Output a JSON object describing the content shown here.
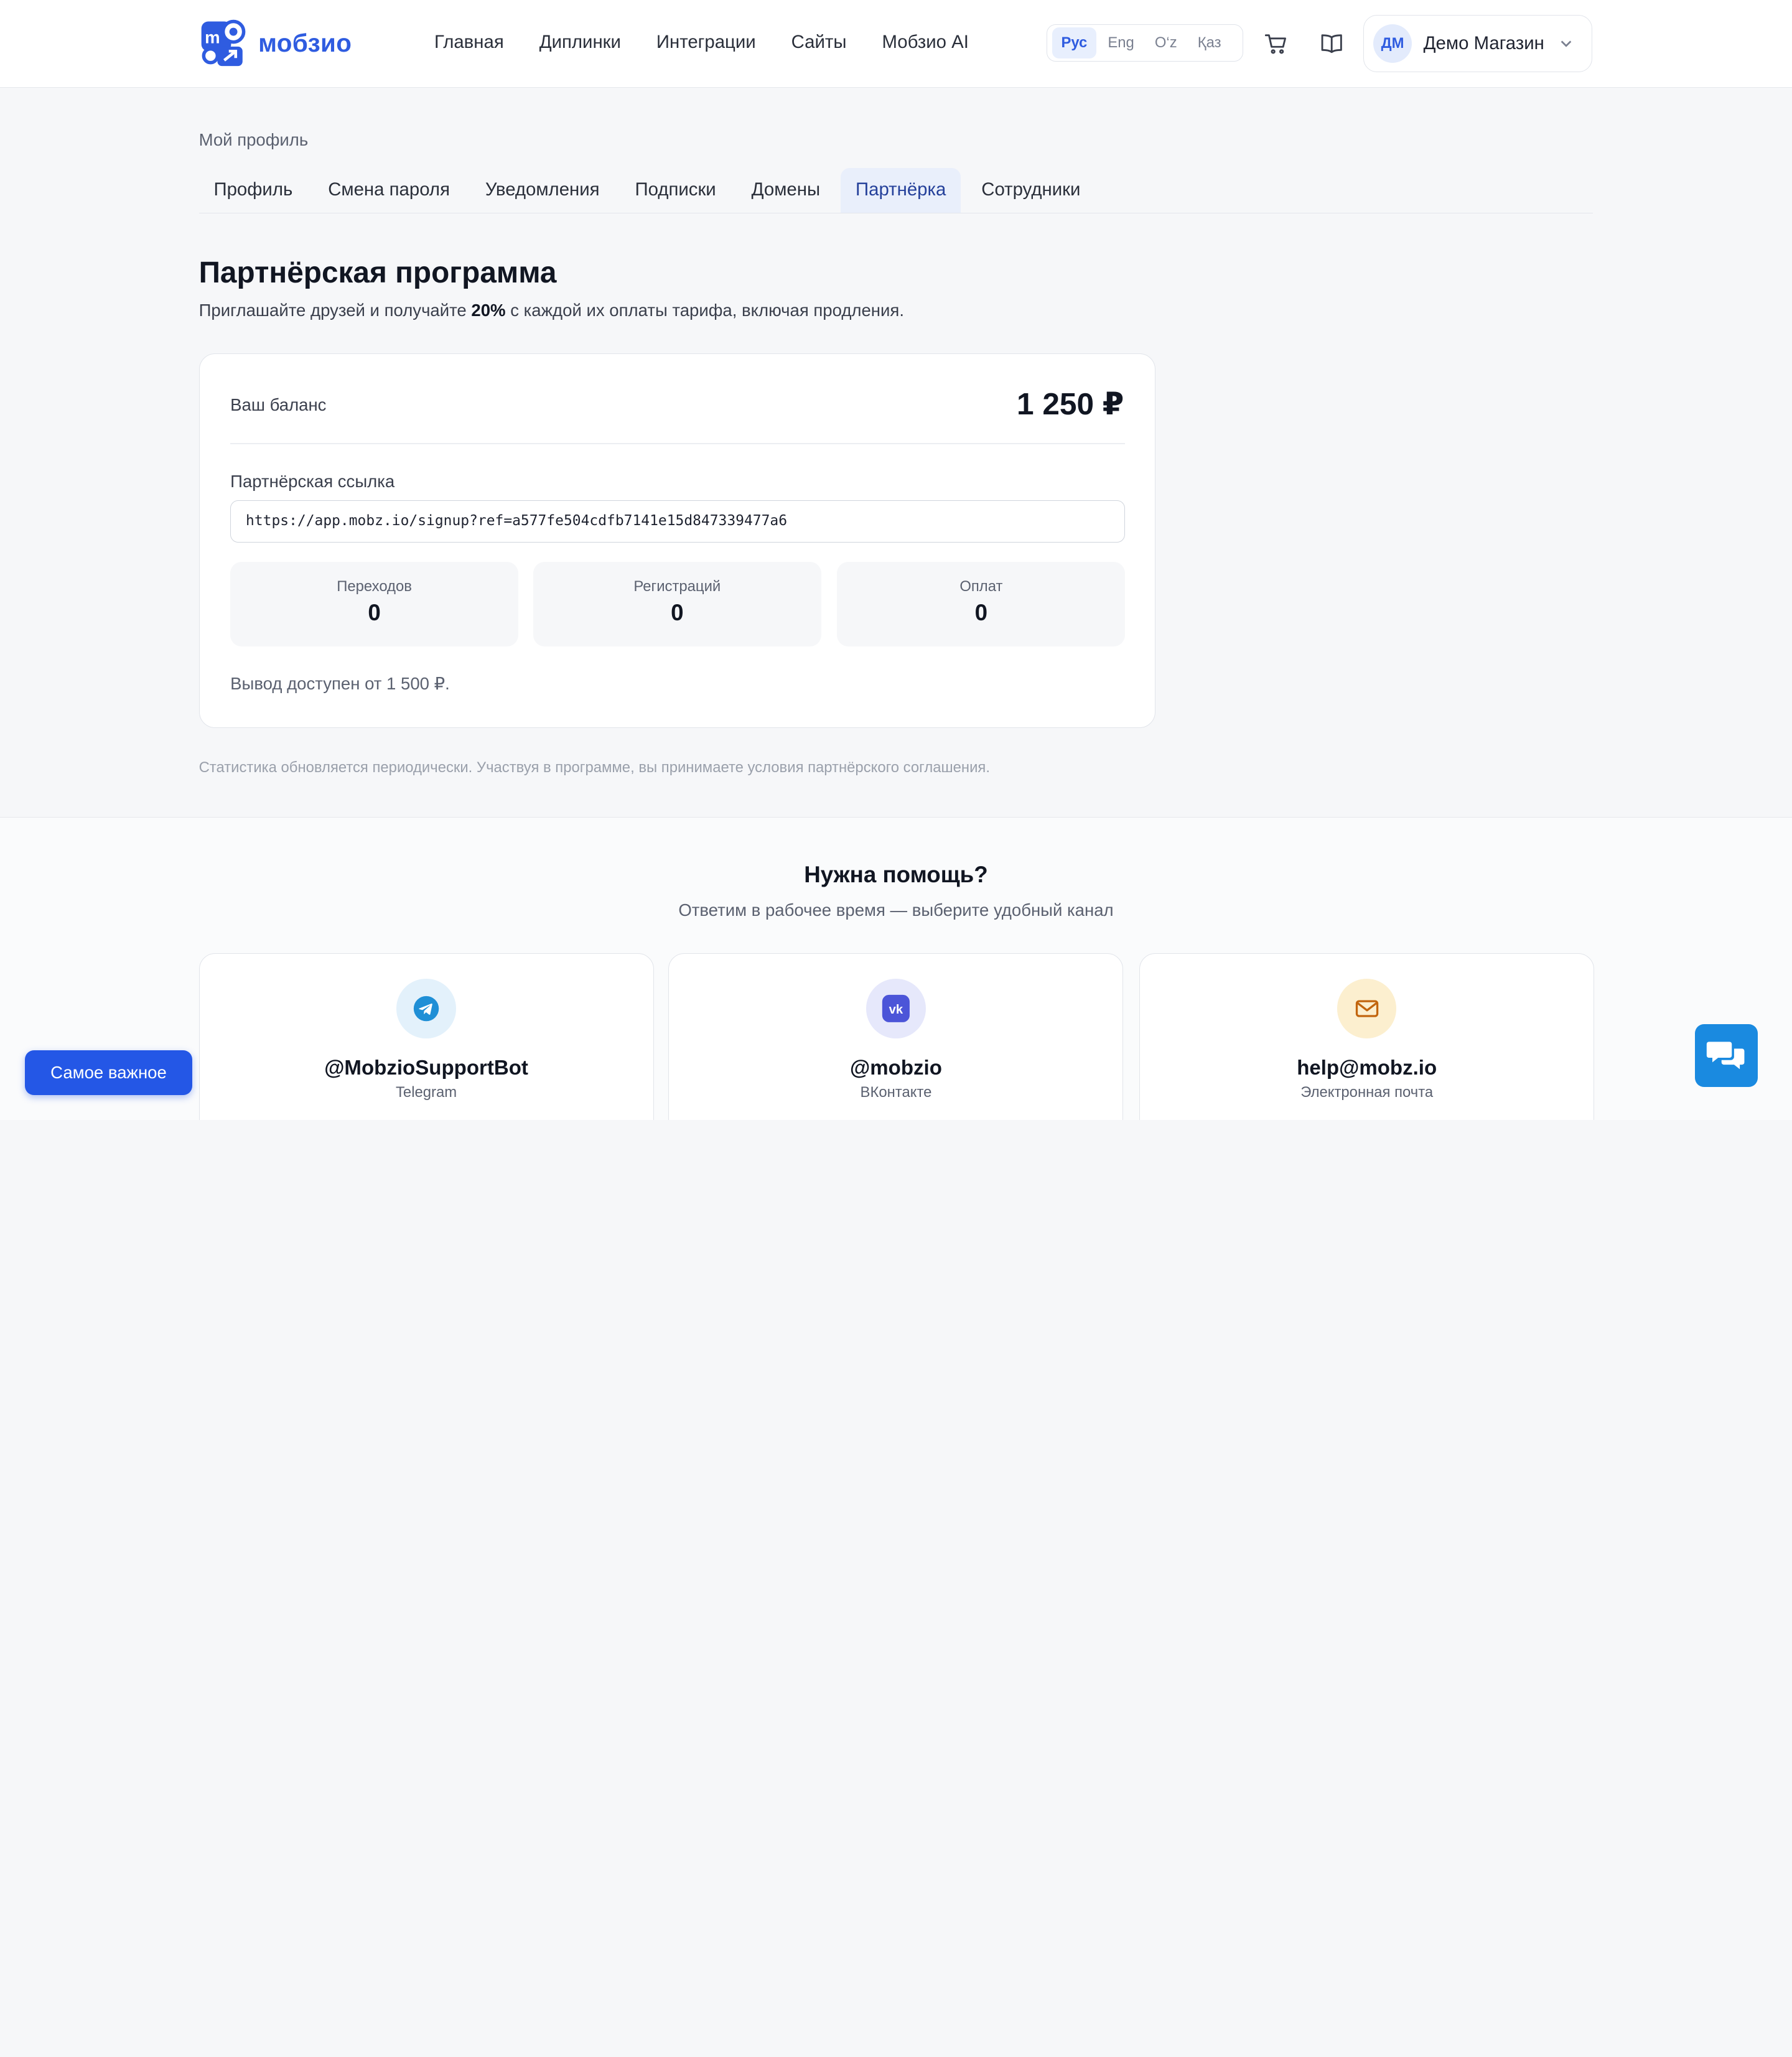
{
  "header": {
    "logo_text": "мобзио",
    "nav": [
      "Главная",
      "Диплинки",
      "Интеграции",
      "Сайты",
      "Мобзио AI"
    ],
    "languages": [
      "Рус",
      "Eng",
      "O‘z",
      "Қаз"
    ],
    "active_language": "Рус",
    "account": {
      "initials": "ДМ",
      "name": "Демо Магазин"
    }
  },
  "profile": {
    "breadcrumb": "Мой профиль",
    "tabs": [
      "Профиль",
      "Смена пароля",
      "Уведомления",
      "Подписки",
      "Домены",
      "Партнёрка",
      "Сотрудники"
    ],
    "active_tab": "Партнёрка"
  },
  "partner": {
    "title": "Партнёрская программа",
    "subtitle_pre": "Приглашайте друзей и получайте ",
    "subtitle_bold": "20%",
    "subtitle_post": " с каждой их оплаты тарифа, включая продления.",
    "balance_label": "Ваш баланс",
    "balance_value": "1 250 ₽",
    "link_label": "Партнёрская ссылка",
    "link_value": "https://app.mobz.io/signup?ref=a577fe504cdfb7141e15d847339477a6",
    "stats": [
      {
        "label": "Переходов",
        "value": "0"
      },
      {
        "label": "Регистраций",
        "value": "0"
      },
      {
        "label": "Оплат",
        "value": "0"
      }
    ],
    "withdraw_note": "Вывод доступен от 1 500 ₽.",
    "footnote": "Статистика обновляется периодически. Участвуя в программе, вы принимаете условия партнёрского соглашения."
  },
  "help": {
    "title": "Нужна помощь?",
    "subtitle": "Ответим в рабочее время — выберите удобный канал",
    "channels": [
      {
        "name": "@MobzioSupportBot",
        "kind": "Telegram",
        "icon": "telegram-icon"
      },
      {
        "name": "@mobzio",
        "kind": "ВКонтакте",
        "icon": "vk-icon"
      },
      {
        "name": "help@mobz.io",
        "kind": "Электронная почта",
        "icon": "mail-icon"
      }
    ]
  },
  "floating": {
    "important_label": "Самое важное"
  },
  "colors": {
    "accent": "#2f5ce0",
    "button": "#2457e6",
    "chat": "#1a8ae0"
  }
}
